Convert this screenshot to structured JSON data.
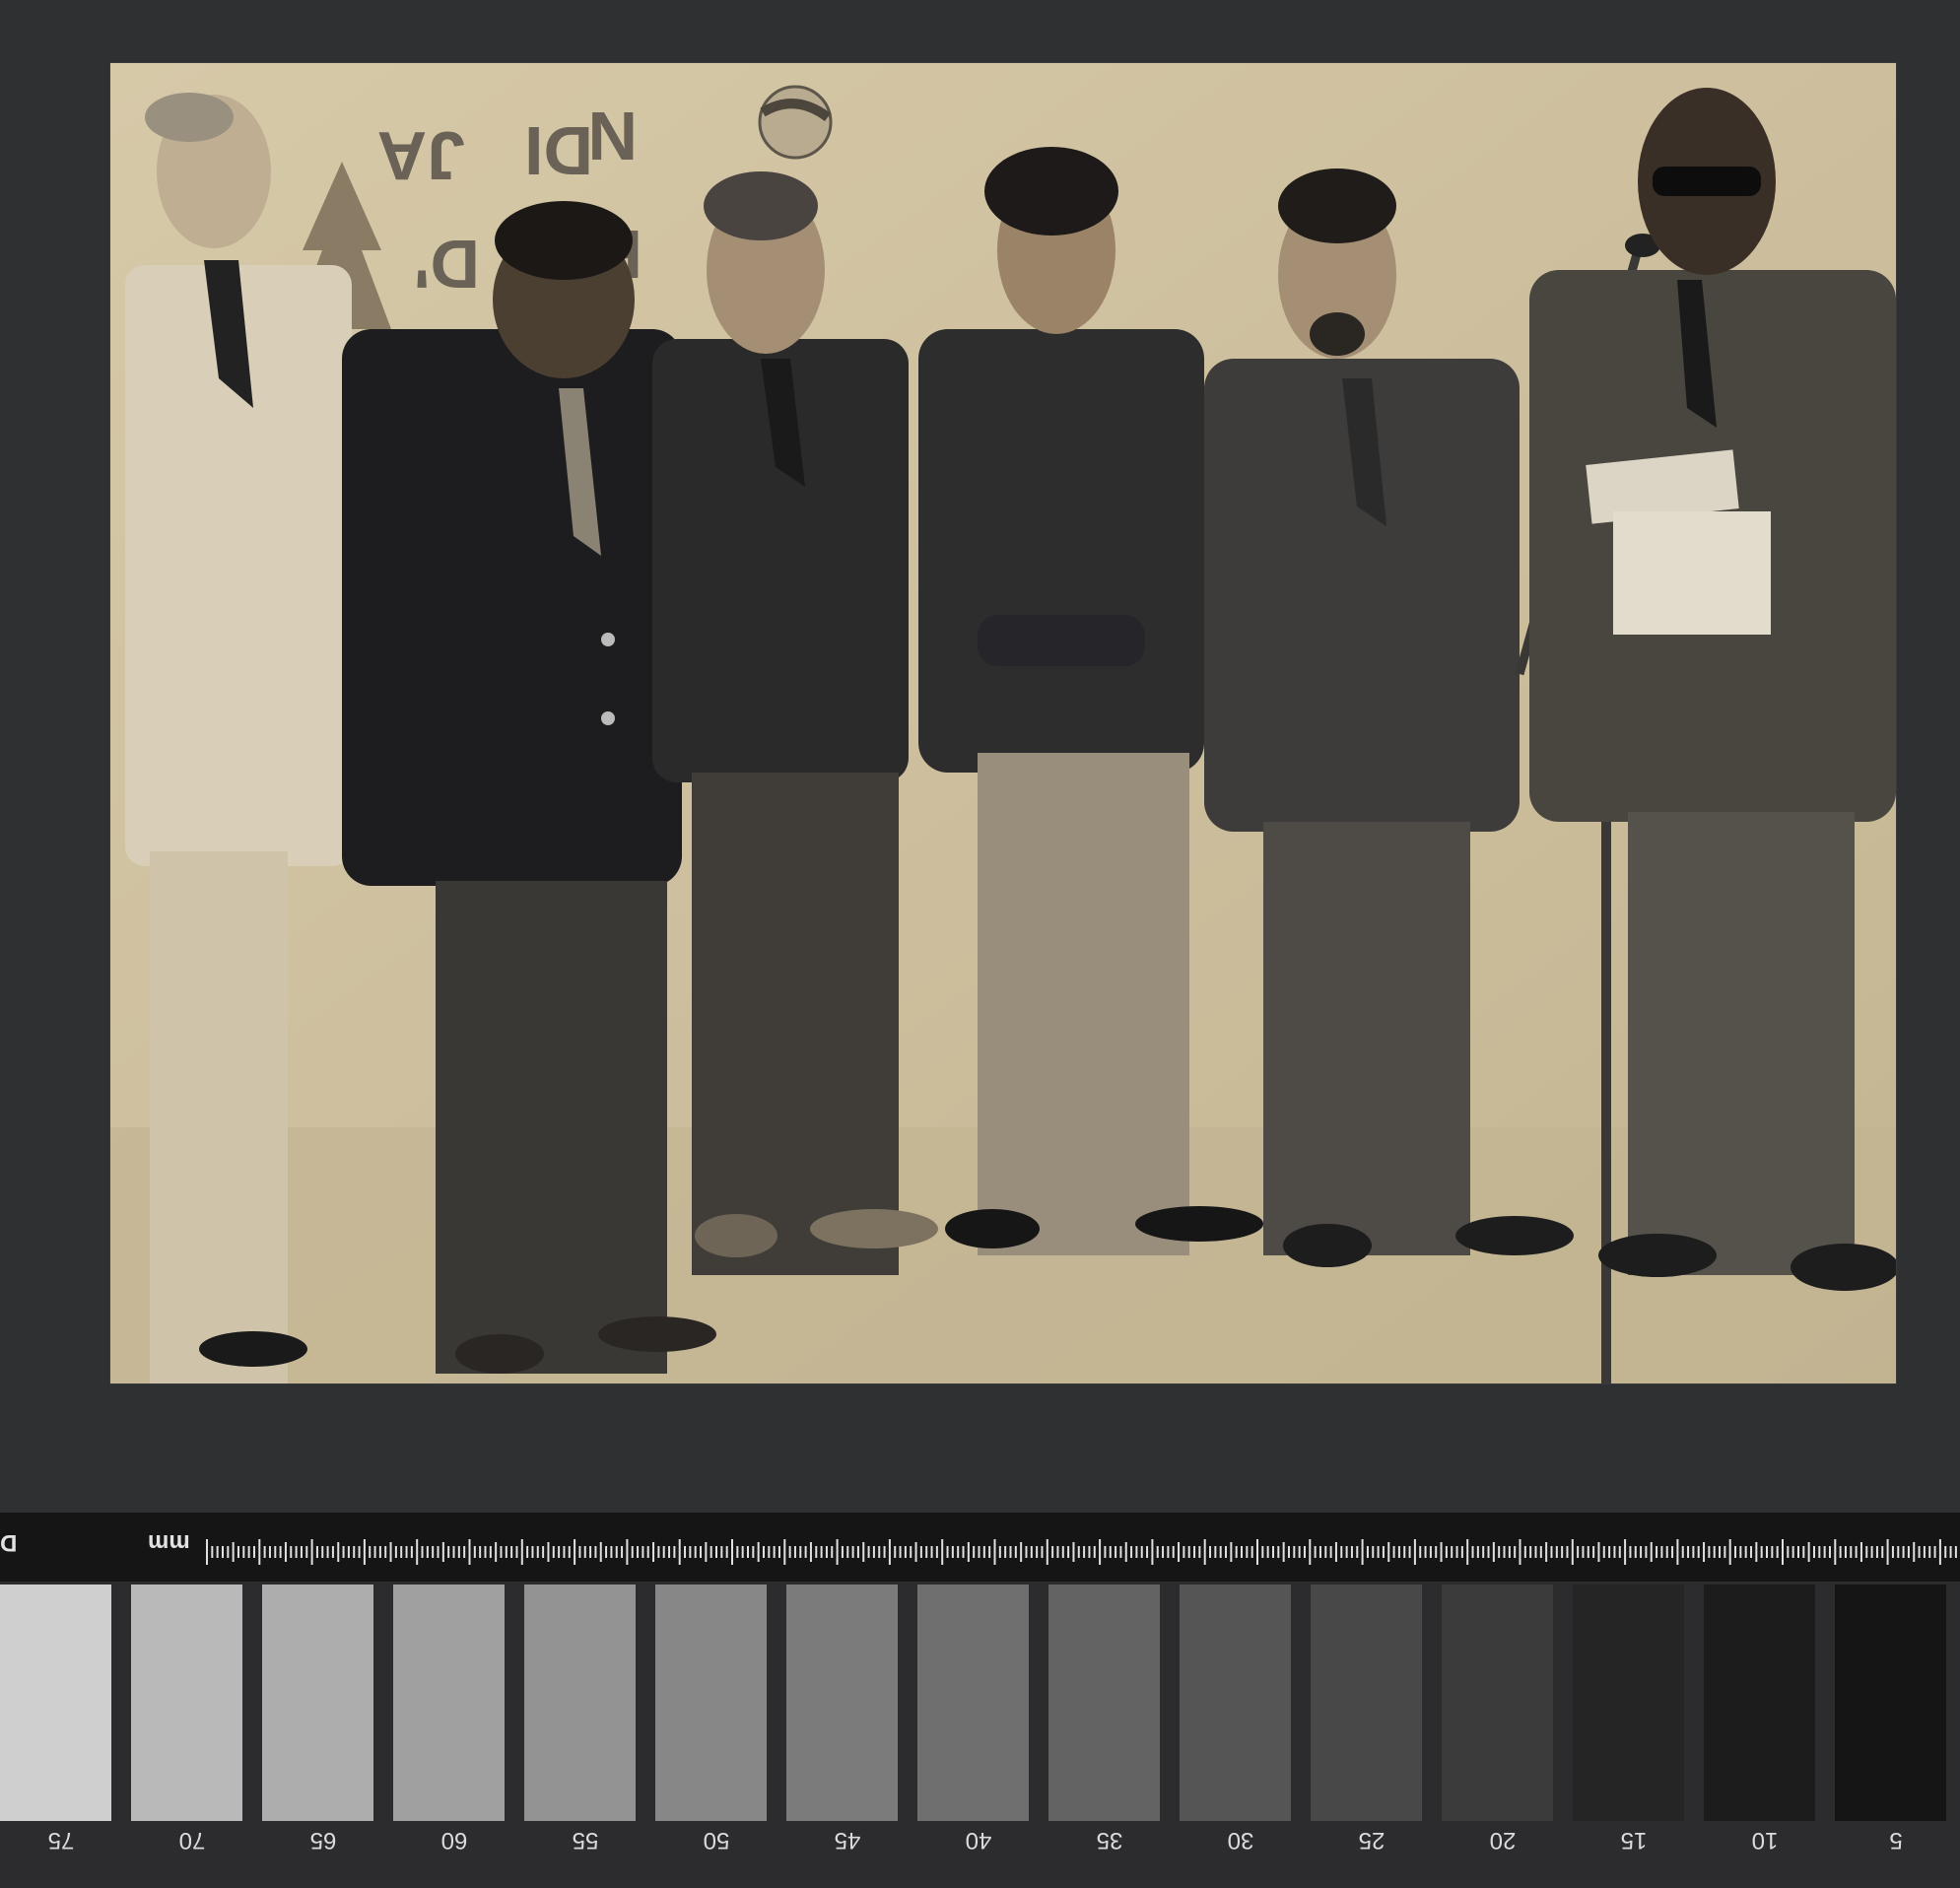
{
  "photo": {
    "wall_lettering": "JARDIN D' EA",
    "people_count": 6
  },
  "ruler": {
    "unit_label": "mm",
    "brand_label": "D"
  },
  "color_target": {
    "patch_colors": [
      "#cfcfcf",
      "#b9b9b9",
      "#adadad",
      "#a0a0a0",
      "#939393",
      "#878787",
      "#7b7b7b",
      "#6f6f6f",
      "#636363",
      "#555555",
      "#484848",
      "#3b3b3b",
      "#252525",
      "#1c1c1c",
      "#151515"
    ],
    "numbers": [
      "75",
      "70",
      "65",
      "60",
      "55",
      "50",
      "45",
      "40",
      "35",
      "30",
      "25",
      "20",
      "15",
      "10",
      "5"
    ]
  }
}
